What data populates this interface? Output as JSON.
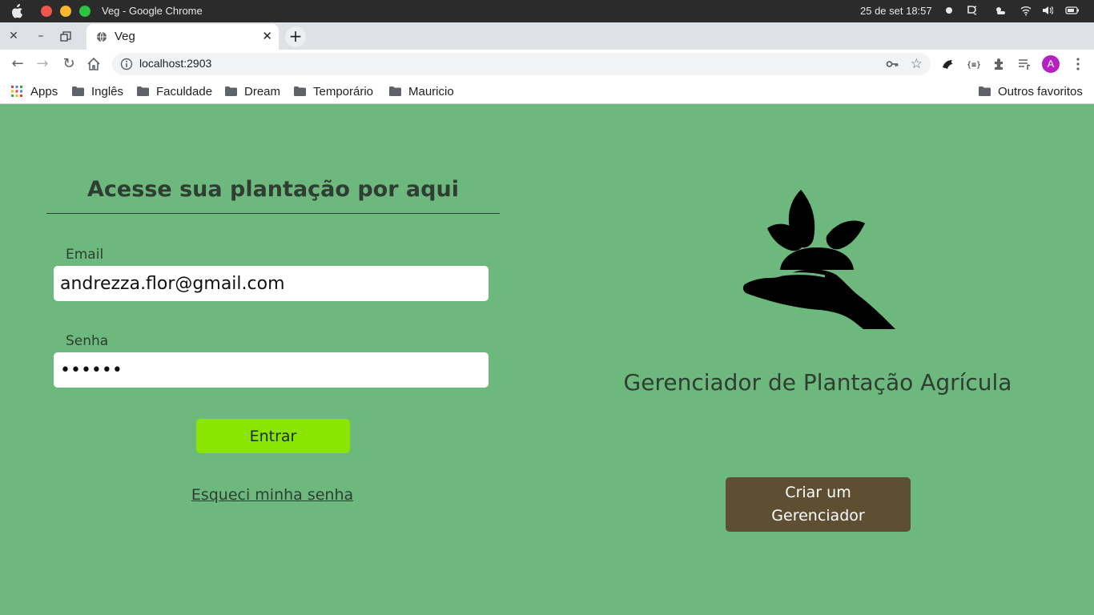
{
  "os": {
    "window_title": "Veg - Google Chrome",
    "clock": "25 de set  18:57"
  },
  "browser": {
    "tab_title": "Veg",
    "url": "localhost:2903",
    "avatar_letter": "A",
    "bookmarks": [
      "Apps",
      "Inglês",
      "Faculdade",
      "Dream",
      "Temporário",
      "Mauricio"
    ],
    "other_bookmarks": "Outros favoritos"
  },
  "login": {
    "title": "Acesse sua plantação por aqui",
    "email_label": "Email",
    "email_value": "andrezza.flor@gmail.com",
    "password_label": "Senha",
    "password_value": "••••••",
    "submit_label": "Entrar",
    "forgot_label": "Esqueci minha senha"
  },
  "brand": {
    "app_name": "Gerenciador de Plantação Agrícula",
    "create_line1": "Criar um",
    "create_line2": "Gerenciador",
    "logo_icon": "hand-holding-plant-icon"
  },
  "colors": {
    "background": "#6db87c",
    "enter_button": "#8ae600",
    "create_button": "#5e4e32"
  }
}
